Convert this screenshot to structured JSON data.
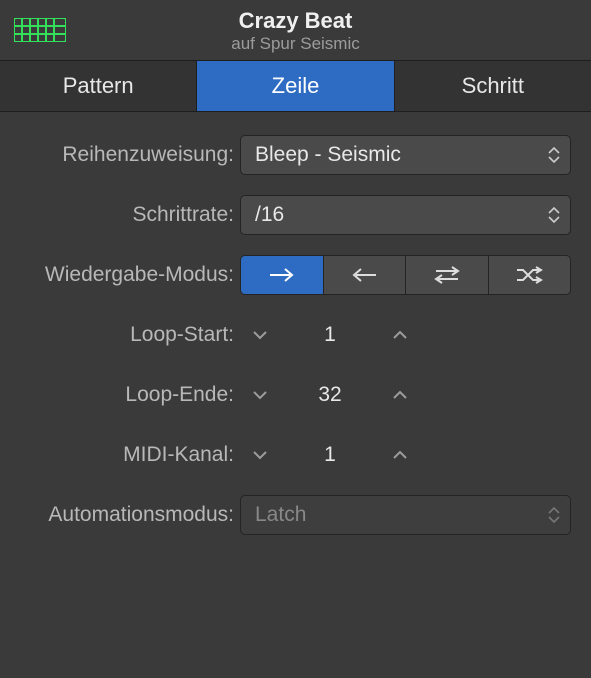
{
  "header": {
    "title": "Crazy Beat",
    "subtitle": "auf Spur Seismic"
  },
  "tabs": [
    {
      "label": "Pattern",
      "active": false
    },
    {
      "label": "Zeile",
      "active": true
    },
    {
      "label": "Schritt",
      "active": false
    }
  ],
  "fields": {
    "assignment": {
      "label": "Reihenzuweisung:",
      "value": "Bleep - Seismic"
    },
    "steprate": {
      "label": "Schrittrate:",
      "value": "/16"
    },
    "playmode": {
      "label": "Wiedergabe-Modus:"
    },
    "loopstart": {
      "label": "Loop-Start:",
      "value": "1"
    },
    "loopend": {
      "label": "Loop-Ende:",
      "value": "32"
    },
    "midich": {
      "label": "MIDI-Kanal:",
      "value": "1"
    },
    "automode": {
      "label": "Automationsmodus:",
      "value": "Latch"
    }
  }
}
